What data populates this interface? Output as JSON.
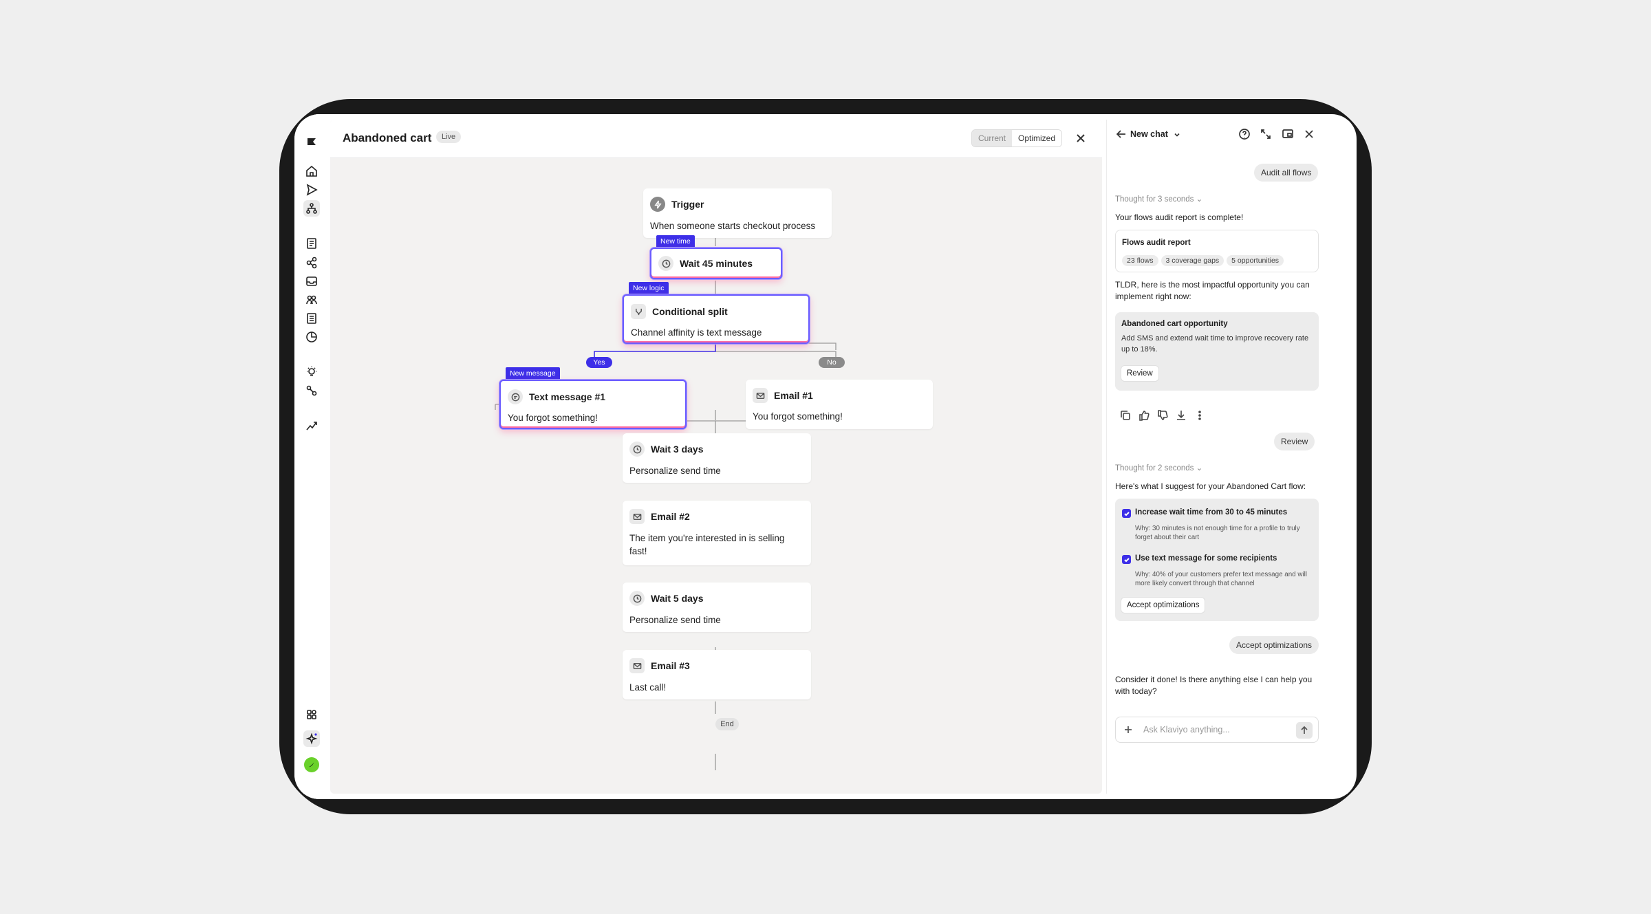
{
  "header": {
    "title": "Abandoned cart",
    "status": "Live",
    "seg_current": "Current",
    "seg_optimized": "Optimized"
  },
  "flow": {
    "trigger": {
      "title": "Trigger",
      "desc": "When someone starts checkout process"
    },
    "wait45": {
      "title": "Wait 45 minutes",
      "tag": "New time"
    },
    "split": {
      "title": "Conditional split",
      "desc": "Channel affinity is text message",
      "tag": "New logic"
    },
    "yes": "Yes",
    "no": "No",
    "text1": {
      "title": "Text message #1",
      "desc": "You forgot something!",
      "tag": "New message"
    },
    "email1": {
      "title": "Email #1",
      "desc": "You forgot something!"
    },
    "wait3": {
      "title": "Wait 3 days",
      "desc": "Personalize send time"
    },
    "email2": {
      "title": "Email #2",
      "desc1": "The item you're interested in is selling",
      "desc2": "fast!"
    },
    "wait5": {
      "title": "Wait 5 days",
      "desc": "Personalize send time"
    },
    "email3": {
      "title": "Email #3",
      "desc": "Last call!"
    },
    "end": "End"
  },
  "chat": {
    "title": "New chat",
    "user_msg1": "Audit all flows",
    "thought1": "Thought for 3 seconds",
    "reply1": "Your flows audit report is complete!",
    "report": {
      "title": "Flows audit report",
      "chips": [
        "23 flows",
        "3 coverage gaps",
        "5 opportunities"
      ]
    },
    "tldr": "TLDR, here is the most impactful opportunity you can implement right now:",
    "opportunity": {
      "title": "Abandoned cart opportunity",
      "desc": "Add SMS and extend wait time to improve recovery rate up to 18%.",
      "button": "Review"
    },
    "user_msg2": "Review",
    "thought2": "Thought for 2 seconds",
    "suggest": "Here's what I suggest for your Abandoned Cart flow:",
    "opt1": {
      "title": "Increase wait time from 30 to 45 minutes",
      "why": "Why: 30 minutes is not enough time for a profile to truly forget about their cart"
    },
    "opt2": {
      "title": "Use text message for some recipients",
      "why": "Why: 40% of your customers prefer text message and will more likely convert through that channel"
    },
    "accept_button": "Accept optimizations",
    "user_msg3": "Accept optimizations",
    "final": "Consider it done! Is there anything else I can help you with today?",
    "input_placeholder": "Ask Klaviyo anything..."
  },
  "colors": {
    "accent": "#3d2fe8",
    "no_pill": "#888888",
    "canvas_bg": "#f3f2f1",
    "highlight_glow": "#ff6fa0"
  }
}
